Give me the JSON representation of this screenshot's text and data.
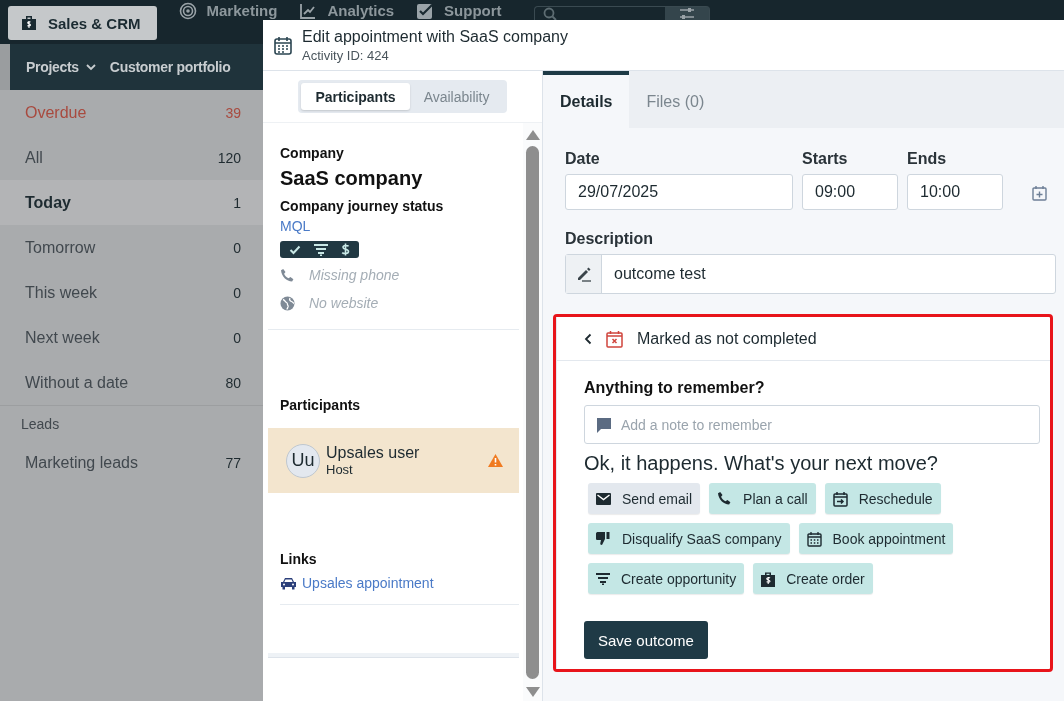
{
  "top_nav": {
    "items": [
      {
        "label": "Sales & CRM",
        "selected": true
      },
      {
        "label": "Marketing",
        "selected": false
      },
      {
        "label": "Analytics",
        "selected": false
      },
      {
        "label": "Support",
        "selected": false
      }
    ]
  },
  "sub_nav": {
    "items": [
      {
        "label": "Projects",
        "dropdown": true
      },
      {
        "label": "Customer portfolio",
        "dropdown": false
      }
    ]
  },
  "sidebar": {
    "items": [
      {
        "label": "Overdue",
        "count": "39",
        "overdue": true,
        "selected": false
      },
      {
        "label": "All",
        "count": "120",
        "overdue": false,
        "selected": false
      },
      {
        "label": "Today",
        "count": "1",
        "overdue": false,
        "selected": true
      },
      {
        "label": "Tomorrow",
        "count": "0",
        "overdue": false,
        "selected": false
      },
      {
        "label": "This week",
        "count": "0",
        "overdue": false,
        "selected": false
      },
      {
        "label": "Next week",
        "count": "0",
        "overdue": false,
        "selected": false
      },
      {
        "label": "Without a date",
        "count": "80",
        "overdue": false,
        "selected": false
      }
    ],
    "sections": [
      {
        "title": "Leads",
        "items": [
          {
            "label": "Marketing leads",
            "count": "77",
            "overdue": false,
            "selected": false
          }
        ]
      }
    ]
  },
  "modal": {
    "title": "Edit appointment with SaaS company",
    "subtitle": "Activity ID: 424",
    "left_tabs": [
      {
        "label": "Participants",
        "selected": true
      },
      {
        "label": "Availability",
        "selected": false
      }
    ],
    "company": {
      "label": "Company",
      "name": "SaaS company",
      "status_label": "Company journey status",
      "status": "MQL",
      "phone": "Missing phone",
      "website": "No website"
    },
    "participants": {
      "label": "Participants",
      "items": [
        {
          "initials": "Uu",
          "name": "Upsales user",
          "role": "Host",
          "warning": true
        }
      ]
    },
    "links": {
      "label": "Links",
      "items": [
        "Upsales appointment"
      ]
    },
    "right_tabs": [
      {
        "label": "Details",
        "selected": true
      },
      {
        "label": "Files (0)",
        "selected": false
      }
    ],
    "date": {
      "label": "Date",
      "value": "29/07/2025"
    },
    "starts": {
      "label": "Starts",
      "value": "09:00"
    },
    "ends": {
      "label": "Ends",
      "value": "10:00"
    },
    "description": {
      "label": "Description",
      "value": "outcome test"
    },
    "outcome": {
      "title": "Marked as not completed",
      "note_label": "Anything to remember?",
      "note_placeholder": "Add a note to remember",
      "prompt": "Ok, it happens. What's your next move?",
      "actions": [
        {
          "label": "Send email",
          "kind": "email",
          "highlighted": false
        },
        {
          "label": "Plan a call",
          "kind": "call",
          "highlighted": true
        },
        {
          "label": "Reschedule",
          "kind": "reschedule",
          "highlighted": true
        },
        {
          "label": "Disqualify SaaS company",
          "kind": "disqualify",
          "highlighted": true
        },
        {
          "label": "Book appointment",
          "kind": "appointment",
          "highlighted": true
        },
        {
          "label": "Create opportunity",
          "kind": "opportunity",
          "highlighted": true
        },
        {
          "label": "Create order",
          "kind": "order",
          "highlighted": true
        }
      ],
      "save_button": "Save outcome"
    }
  }
}
